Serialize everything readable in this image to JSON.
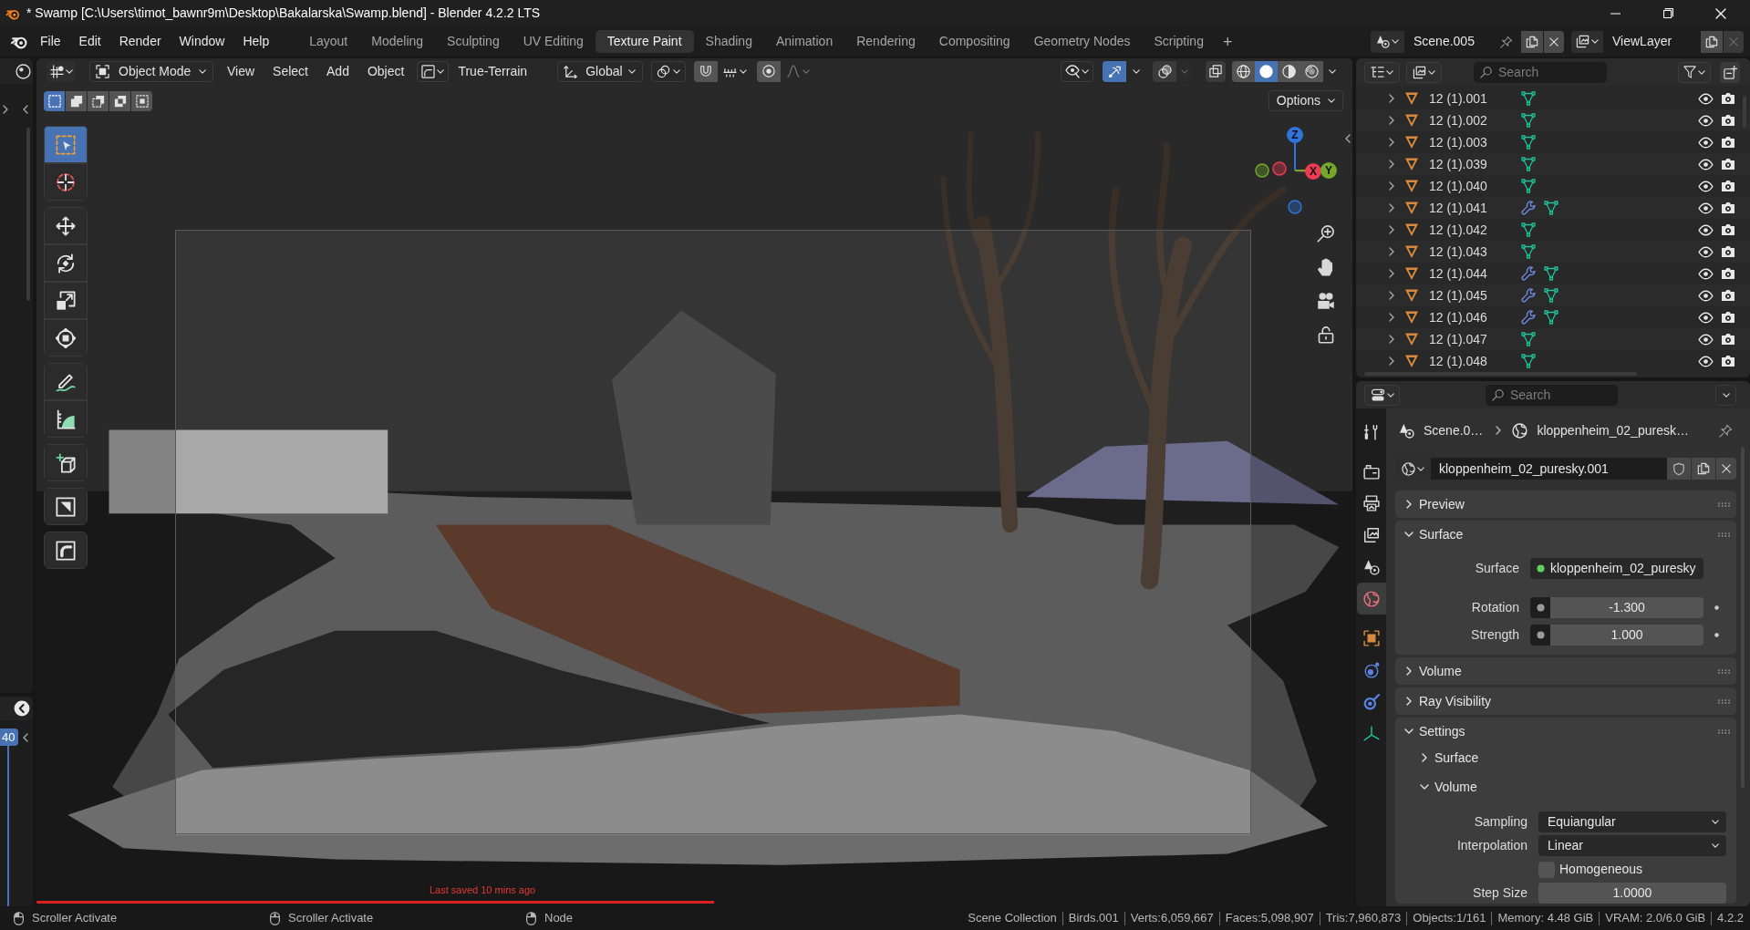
{
  "title_bar": {
    "title": "* Swamp [C:\\Users\\timot_bawnr9m\\Desktop\\Bakalarska\\Swamp.blend] - Blender 4.2.2 LTS",
    "controls": [
      {
        "kind": "minimize"
      },
      {
        "kind": "restore"
      },
      {
        "kind": "close"
      }
    ]
  },
  "top_bar": {
    "menus": [
      "File",
      "Edit",
      "Render",
      "Window",
      "Help"
    ],
    "workspaces": [
      {
        "label": "Layout",
        "selected": false
      },
      {
        "label": "Modeling",
        "selected": false
      },
      {
        "label": "Sculpting",
        "selected": false
      },
      {
        "label": "UV Editing",
        "selected": false
      },
      {
        "label": "Texture Paint",
        "selected": true
      },
      {
        "label": "Shading",
        "selected": false
      },
      {
        "label": "Animation",
        "selected": false
      },
      {
        "label": "Rendering",
        "selected": false
      },
      {
        "label": "Compositing",
        "selected": false
      },
      {
        "label": "Geometry Nodes",
        "selected": false
      },
      {
        "label": "Scripting",
        "selected": false
      }
    ],
    "add_workspace": "+",
    "scene": "Scene.005",
    "view_layer": "ViewLayer"
  },
  "timeline": {
    "current_frame": "40"
  },
  "viewport": {
    "mode": "Object Mode",
    "menus": [
      "View",
      "Select",
      "Add",
      "Object"
    ],
    "brush": "True-Terrain",
    "orientation": "Global",
    "gizmos": true,
    "overlays": false,
    "shading": [
      {
        "kind": "wireframe",
        "selected": false
      },
      {
        "kind": "solid",
        "selected": true
      },
      {
        "kind": "material",
        "selected": false
      },
      {
        "kind": "rendered",
        "selected": false
      }
    ],
    "select_modes": [
      {
        "kind": "set",
        "selected": true
      },
      {
        "kind": "extend",
        "selected": false
      },
      {
        "kind": "subtract",
        "selected": false
      },
      {
        "kind": "invert",
        "selected": false
      },
      {
        "kind": "intersect",
        "selected": false
      }
    ],
    "options": "Options",
    "tool_groups": [
      [
        {
          "kind": "select_box",
          "selected": true
        },
        {
          "kind": "cursor",
          "selected": false
        }
      ],
      [
        {
          "kind": "move",
          "selected": false
        },
        {
          "kind": "rotate",
          "selected": false
        },
        {
          "kind": "scale",
          "selected": false
        },
        {
          "kind": "transform",
          "selected": false
        }
      ],
      [
        {
          "kind": "annotate",
          "selected": false
        },
        {
          "kind": "measure",
          "selected": false
        }
      ],
      [
        {
          "kind": "add_cube",
          "selected": false
        }
      ],
      [
        {
          "kind": "framed_triangle",
          "selected": false
        }
      ],
      [
        {
          "kind": "framed_bend",
          "selected": false
        }
      ]
    ],
    "axes": [
      {
        "label": "Z",
        "color": "#2f73db"
      },
      {
        "label": "X",
        "color": "#ed3a55"
      },
      {
        "label": "Y",
        "color": "#74a82c"
      }
    ],
    "report": "Last saved 10 mins ago"
  },
  "outliner": {
    "search": {
      "placeholder": "Search"
    },
    "rows": [
      {
        "name": "12 (1).001",
        "modifiers": false
      },
      {
        "name": "12 (1).002",
        "modifiers": false
      },
      {
        "name": "12 (1).003",
        "modifiers": false
      },
      {
        "name": "12 (1).039",
        "modifiers": false
      },
      {
        "name": "12 (1).040",
        "modifiers": false
      },
      {
        "name": "12 (1).041",
        "modifiers": true
      },
      {
        "name": "12 (1).042",
        "modifiers": false
      },
      {
        "name": "12 (1).043",
        "modifiers": false
      },
      {
        "name": "12 (1).044",
        "modifiers": true
      },
      {
        "name": "12 (1).045",
        "modifiers": true
      },
      {
        "name": "12 (1).046",
        "modifiers": true
      },
      {
        "name": "12 (1).047",
        "modifiers": false
      },
      {
        "name": "12 (1).048",
        "modifiers": false
      }
    ]
  },
  "properties": {
    "search": {
      "placeholder": "Search"
    },
    "tab_groups": [
      [
        {
          "kind": "tool",
          "selected": false
        }
      ],
      [
        {
          "kind": "render",
          "selected": false
        },
        {
          "kind": "output",
          "selected": false
        },
        {
          "kind": "view_layer",
          "selected": false
        },
        {
          "kind": "scene",
          "selected": false
        },
        {
          "kind": "world",
          "selected": true
        }
      ],
      [
        {
          "kind": "object",
          "selected": false
        },
        {
          "kind": "physics",
          "selected": false
        },
        {
          "kind": "constraints",
          "selected": false
        },
        {
          "kind": "data",
          "selected": false
        }
      ]
    ],
    "breadcrumb": [
      {
        "kind": "scene",
        "label": "Scene.0…"
      },
      {
        "kind": "world",
        "label": "kloppenheim_02_puresk…"
      }
    ],
    "world": {
      "name": "kloppenheim_02_puresky.001"
    },
    "panels": [
      {
        "title": "Preview",
        "expanded": false
      },
      {
        "title": "Surface",
        "expanded": true,
        "fields": [
          {
            "kind": "link",
            "label": "Surface",
            "value": "kloppenheim_02_puresky"
          },
          {
            "kind": "socket_value",
            "label": "Rotation",
            "value": "-1.300"
          },
          {
            "kind": "socket_value",
            "label": "Strength",
            "value": "1.000"
          }
        ]
      },
      {
        "title": "Volume",
        "expanded": false
      },
      {
        "title": "Ray Visibility",
        "expanded": false
      },
      {
        "title": "Settings",
        "expanded": true,
        "subpanels": [
          {
            "title": "Surface",
            "expanded": false
          },
          {
            "title": "Volume",
            "expanded": true,
            "fields": [
              {
                "kind": "dropdown",
                "label": "Sampling",
                "value": "Equiangular"
              },
              {
                "kind": "dropdown",
                "label": "Interpolation",
                "value": "Linear"
              },
              {
                "kind": "checkbox",
                "label": "Homogeneous",
                "checked": false
              },
              {
                "kind": "number",
                "label": "Step Size",
                "value": "1.0000"
              }
            ]
          }
        ]
      }
    ]
  },
  "status_bar": {
    "hints": [
      {
        "kind": "left_mouse",
        "label": "Scroller Activate"
      },
      {
        "kind": "middle_mouse",
        "label": "Scroller Activate"
      },
      {
        "kind": "right_mouse",
        "label": "Node"
      }
    ],
    "stats": [
      "Scene Collection",
      "Birds.001",
      "Verts:6,059,667",
      "Faces:5,098,907",
      "Tris:7,960,873",
      "Objects:1/161",
      "Memory: 4.48 GiB",
      "VRAM: 2.0/6.0 GiB",
      "4.2.2"
    ]
  }
}
